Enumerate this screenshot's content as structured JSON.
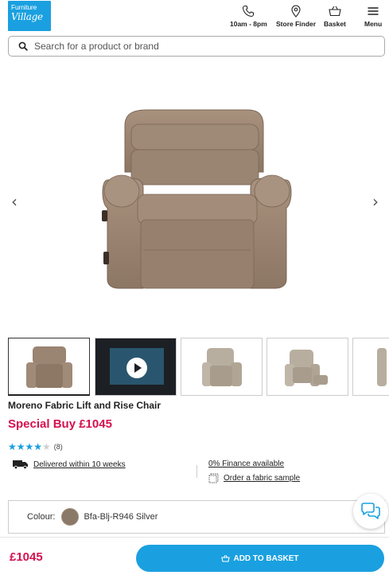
{
  "header": {
    "logo_line1": "Furniture",
    "logo_line2": "Village",
    "nav": {
      "hours": "10am - 8pm",
      "store_finder": "Store Finder",
      "basket": "Basket",
      "menu": "Menu"
    }
  },
  "search": {
    "placeholder": "Search for a product or brand"
  },
  "gallery": {
    "prev_arrow": "‹",
    "next_arrow": "›"
  },
  "product": {
    "title": "Moreno Fabric Lift and Rise Chair",
    "price_label": "Special Buy",
    "price": "£1045",
    "rating": 4,
    "rating_max": 5,
    "rating_count": "(8)"
  },
  "perks": {
    "delivery": "Delivered within 10 weeks",
    "finance": "0% Finance available",
    "sample": "Order a fabric sample"
  },
  "colour": {
    "label": "Colour:",
    "value": "Bfa-Blj-R946 Silver",
    "swatch_color": "#8b7967"
  },
  "bottom_bar": {
    "price": "£1045",
    "add_to_basket": "ADD TO BASKET"
  },
  "colors": {
    "brand_blue": "#1aa0e0",
    "price_pink": "#d4114f"
  }
}
